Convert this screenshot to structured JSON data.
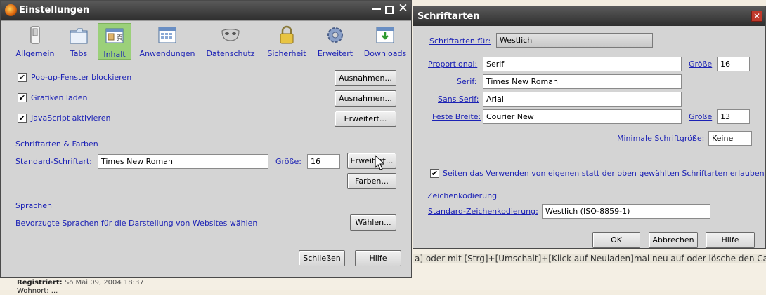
{
  "background": {
    "text_line": "a] oder mit [Strg]+[Umschalt]+[Klick auf Neuladen]mal neu auf oder lösche den Cache",
    "registered_label": "Registriert:",
    "registered_value": "So Mai 09, 2004 18:37",
    "cut_text": "Wohnort: ..."
  },
  "settings": {
    "title": "Einstellungen",
    "tabs": [
      {
        "label": "Allgemein",
        "icon": "switch-icon"
      },
      {
        "label": "Tabs",
        "icon": "tabs-icon"
      },
      {
        "label": "Inhalt",
        "icon": "content-icon"
      },
      {
        "label": "Anwendungen",
        "icon": "applications-icon"
      },
      {
        "label": "Datenschutz",
        "icon": "mask-icon"
      },
      {
        "label": "Sicherheit",
        "icon": "lock-icon"
      },
      {
        "label": "Erweitert",
        "icon": "gear-icon"
      },
      {
        "label": "Downloads",
        "icon": "download-icon"
      }
    ],
    "options": [
      {
        "label": "Pop-up-Fenster blockieren",
        "checked": true,
        "button": "Ausnahmen..."
      },
      {
        "label": "Grafiken laden",
        "checked": true,
        "button": "Ausnahmen..."
      },
      {
        "label": "JavaScript aktivieren",
        "checked": true,
        "button": "Erweitert..."
      }
    ],
    "fonts_section": "Schriftarten & Farben",
    "default_font_label": "Standard-Schriftart:",
    "default_font_value": "Times New Roman",
    "size_label": "Größe:",
    "size_value": "16",
    "advanced_button": "Erweitert...",
    "colors_button": "Farben...",
    "languages_section": "Sprachen",
    "languages_text": "Bevorzugte Sprachen für die Darstellung von Websites wählen",
    "choose_button": "Wählen...",
    "close_button": "Schließen",
    "help_button": "Hilfe"
  },
  "fonts": {
    "title": "Schriftarten",
    "for_label": "Schriftarten für:",
    "for_value": "Westlich",
    "proportional_label": "Proportional:",
    "proportional_value": "Serif",
    "size_label": "Größe",
    "proportional_size": "16",
    "serif_label": "Serif:",
    "serif_value": "Times New Roman",
    "sans_label": "Sans Serif:",
    "sans_value": "Arial",
    "mono_label": "Feste Breite:",
    "mono_value": "Courier New",
    "mono_size": "13",
    "min_size_label": "Minimale Schriftgröße:",
    "min_size_value": "Keine",
    "allow_label": "Seiten das Verwenden von eigenen statt der oben gewählten Schriftarten erlauben",
    "allow_checked": true,
    "encoding_section": "Zeichenkodierung",
    "encoding_label": "Standard-Zeichenkodierung:",
    "encoding_value": "Westlich (ISO-8859-1)",
    "ok_button": "OK",
    "cancel_button": "Abbrechen",
    "help_button": "Hilfe"
  }
}
